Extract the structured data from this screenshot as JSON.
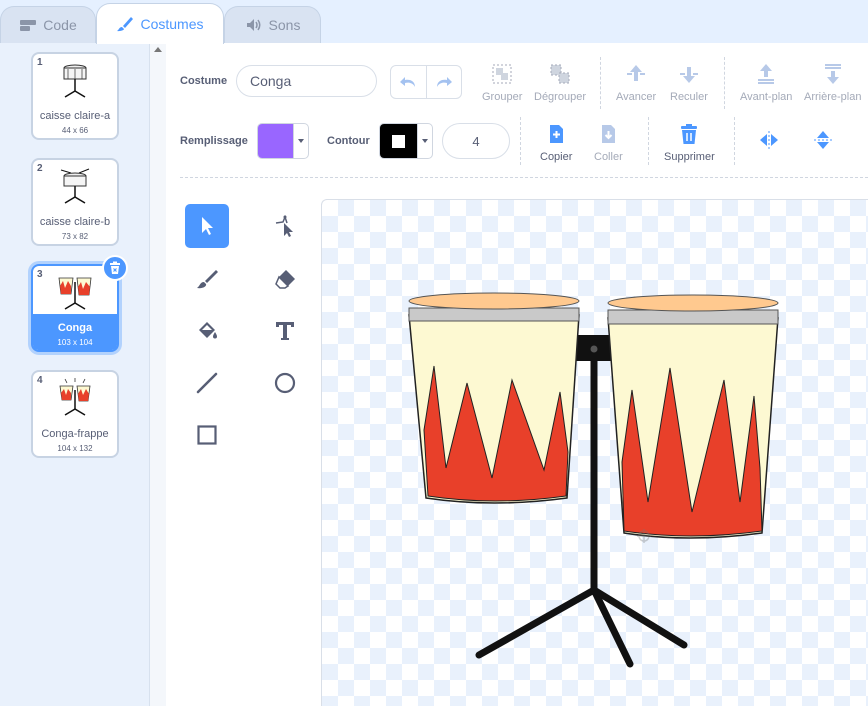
{
  "tabs": [
    {
      "label": "Code",
      "icon": "code-icon"
    },
    {
      "label": "Costumes",
      "icon": "paintbrush-icon"
    },
    {
      "label": "Sons",
      "icon": "speaker-icon"
    }
  ],
  "costumes": [
    {
      "num": "1",
      "name": "caisse claire-a",
      "size": "44 x 66"
    },
    {
      "num": "2",
      "name": "caisse claire-b",
      "size": "73 x 82"
    },
    {
      "num": "3",
      "name": "Conga",
      "size": "103 x 104"
    },
    {
      "num": "4",
      "name": "Conga-frappe",
      "size": "104 x 132"
    }
  ],
  "toolbar": {
    "costume_label": "Costume",
    "costume_name": "Conga",
    "group": "Grouper",
    "ungroup": "Dégrouper",
    "forward": "Avancer",
    "backward": "Reculer",
    "front": "Avant-plan",
    "back": "Arrière-plan",
    "fill_label": "Remplissage",
    "fill_color": "#9966ff",
    "outline_label": "Contour",
    "outline_color": "#000000",
    "outline_width": "4",
    "copy": "Copier",
    "paste": "Coller",
    "delete": "Supprimer"
  },
  "colors": {
    "accent": "#4c97ff",
    "drum_red": "#e8402a",
    "drum_cream": "#fdf9d2",
    "drum_top": "#ffc98f",
    "rim": "#c9c9c9"
  }
}
